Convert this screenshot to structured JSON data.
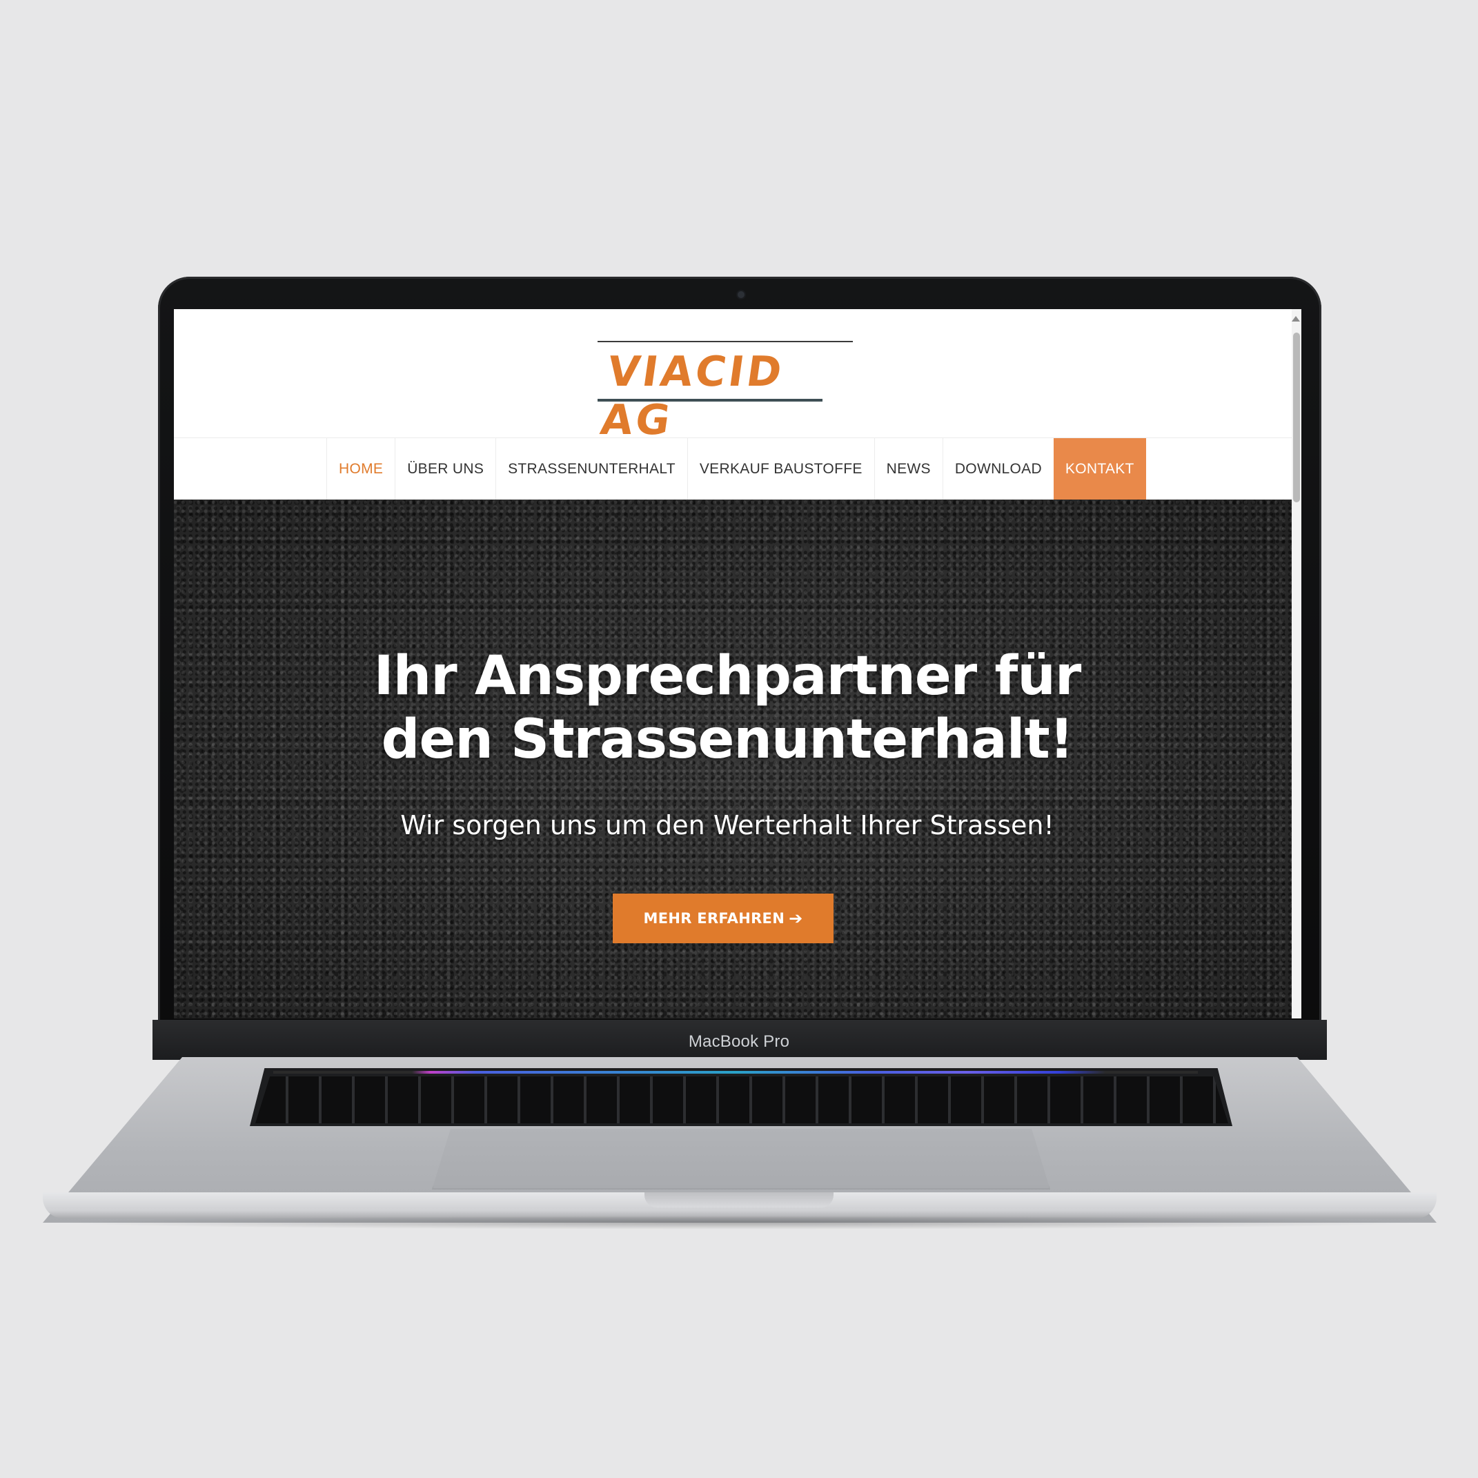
{
  "device": {
    "label": "MacBook Pro"
  },
  "site": {
    "logo_text": "VIACID AG",
    "nav": {
      "items": [
        {
          "label": "HOME",
          "state": "active"
        },
        {
          "label": "ÜBER UNS"
        },
        {
          "label": "STRASSENUNTERHALT"
        },
        {
          "label": "VERKAUF BAUSTOFFE"
        },
        {
          "label": "NEWS"
        },
        {
          "label": "DOWNLOAD"
        },
        {
          "label": "KONTAKT",
          "state": "cta"
        }
      ]
    },
    "hero": {
      "title_line1": "Ihr Ansprechpartner für",
      "title_line2": "den Strassenunterhalt!",
      "subtitle": "Wir sorgen uns um den Werterhalt Ihrer Strassen!",
      "button_label": "MEHR ERFAHREN",
      "button_icon": "arrow-right-icon"
    }
  },
  "colors": {
    "brand_orange": "#e07b2c",
    "cta_orange": "#e9894a",
    "background": "#e7e7e8"
  }
}
